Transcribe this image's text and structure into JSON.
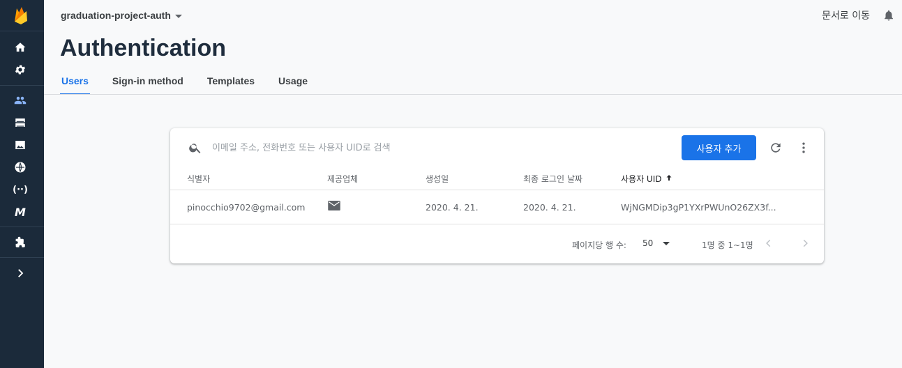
{
  "header": {
    "project_name": "graduation-project-auth",
    "docs_link": "문서로 이동"
  },
  "page": {
    "title": "Authentication"
  },
  "tabs": [
    {
      "label": "Users",
      "active": true
    },
    {
      "label": "Sign-in method",
      "active": false
    },
    {
      "label": "Templates",
      "active": false
    },
    {
      "label": "Usage",
      "active": false
    }
  ],
  "search": {
    "placeholder": "이메일 주소, 전화번호 또는 사용자 UID로 검색"
  },
  "actions": {
    "add_user_label": "사용자 추가"
  },
  "table": {
    "columns": [
      "식별자",
      "제공업체",
      "생성일",
      "최종 로그인 날짜",
      "사용자 UID"
    ],
    "sorted_column": "사용자 UID",
    "rows": [
      {
        "identifier": "pinocchio9702@gmail.com",
        "provider_icon": "mail-icon",
        "created": "2020. 4. 21.",
        "last_sign_in": "2020. 4. 21.",
        "uid": "WjNGMDip3gP1YXrPWUnO26ZX3f..."
      }
    ]
  },
  "pagination": {
    "rows_per_page_label": "페이지당 행 수:",
    "rows_per_page": "50",
    "range": "1명 중 1~1명"
  },
  "sidebar": {
    "icons": [
      "firebase-logo",
      "home-icon",
      "settings-icon",
      "users-icon",
      "database-icon",
      "storage-icon",
      "hosting-icon",
      "functions-icon",
      "ml-icon",
      "extensions-icon",
      "expand-icon"
    ],
    "functions_glyph": "(··)",
    "ml_glyph": "M"
  },
  "colors": {
    "accent": "#1a73e8",
    "sidebar_bg": "#1b2a3a",
    "page_bg": "#f8f9fa"
  }
}
